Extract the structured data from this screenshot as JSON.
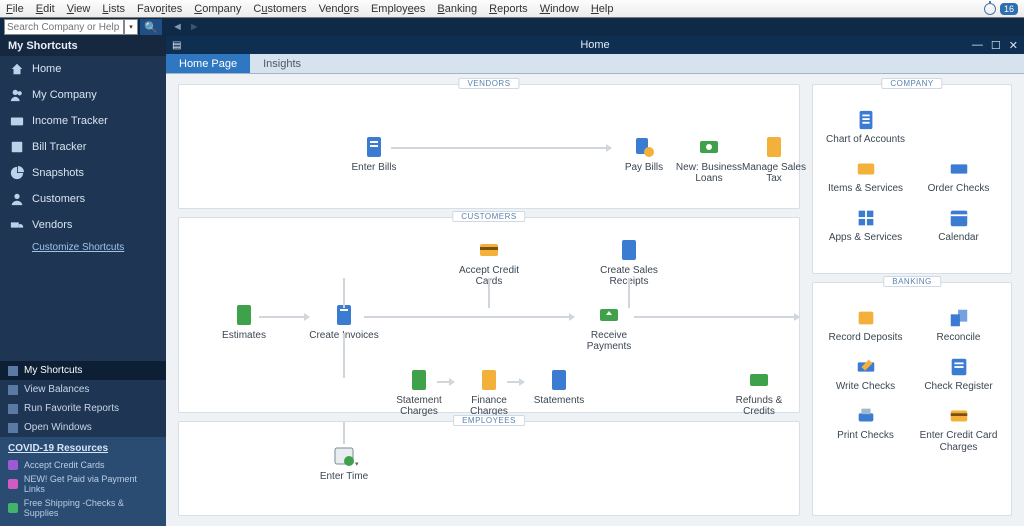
{
  "menubar": {
    "items": [
      "File",
      "Edit",
      "View",
      "Lists",
      "Favorites",
      "Company",
      "Customers",
      "Vendors",
      "Employees",
      "Banking",
      "Reports",
      "Window",
      "Help"
    ],
    "badge": "16"
  },
  "search": {
    "placeholder": "Search Company or Help"
  },
  "window": {
    "title": "Home",
    "tabs": [
      {
        "label": "Home Page",
        "active": true
      },
      {
        "label": "Insights",
        "active": false
      }
    ]
  },
  "sidebar": {
    "shortcuts_header": "My Shortcuts",
    "items": [
      {
        "label": "Home"
      },
      {
        "label": "My Company"
      },
      {
        "label": "Income Tracker"
      },
      {
        "label": "Bill Tracker"
      },
      {
        "label": "Snapshots"
      },
      {
        "label": "Customers"
      },
      {
        "label": "Vendors"
      }
    ],
    "customize_link": "Customize Shortcuts",
    "panels": [
      {
        "label": "My Shortcuts",
        "selected": true
      },
      {
        "label": "View Balances",
        "selected": false
      },
      {
        "label": "Run Favorite Reports",
        "selected": false
      },
      {
        "label": "Open Windows",
        "selected": false
      }
    ],
    "covid": {
      "header": "COVID-19 Resources",
      "links": [
        "Accept Credit Cards",
        "NEW! Get Paid via Payment Links",
        "Free Shipping -Checks & Supplies"
      ]
    }
  },
  "flow": {
    "vendors": {
      "title": "VENDORS",
      "nodes": {
        "enter_bills": "Enter Bills",
        "pay_bills": "Pay Bills",
        "new_business_loans": "New: Business Loans",
        "manage_sales_tax": "Manage Sales Tax"
      }
    },
    "customers": {
      "title": "CUSTOMERS",
      "nodes": {
        "estimates": "Estimates",
        "create_invoices": "Create Invoices",
        "accept_credit_cards": "Accept Credit Cards",
        "create_sales_receipts": "Create Sales Receipts",
        "receive_payments": "Receive Payments",
        "statement_charges": "Statement Charges",
        "finance_charges": "Finance Charges",
        "statements": "Statements",
        "refunds_credits": "Refunds & Credits"
      }
    },
    "employees": {
      "title": "EMPLOYEES",
      "nodes": {
        "enter_time": "Enter Time"
      }
    }
  },
  "right": {
    "company": {
      "title": "COMPANY",
      "tiles": [
        {
          "label": "Chart of Accounts"
        },
        {
          "label": ""
        },
        {
          "label": "Items & Services"
        },
        {
          "label": "Order Checks"
        },
        {
          "label": "Apps & Services"
        },
        {
          "label": "Calendar"
        }
      ]
    },
    "banking": {
      "title": "BANKING",
      "tiles": [
        {
          "label": "Record Deposits"
        },
        {
          "label": "Reconcile"
        },
        {
          "label": "Write Checks"
        },
        {
          "label": "Check Register"
        },
        {
          "label": "Print Checks"
        },
        {
          "label": "Enter Credit Card Charges"
        }
      ]
    }
  }
}
